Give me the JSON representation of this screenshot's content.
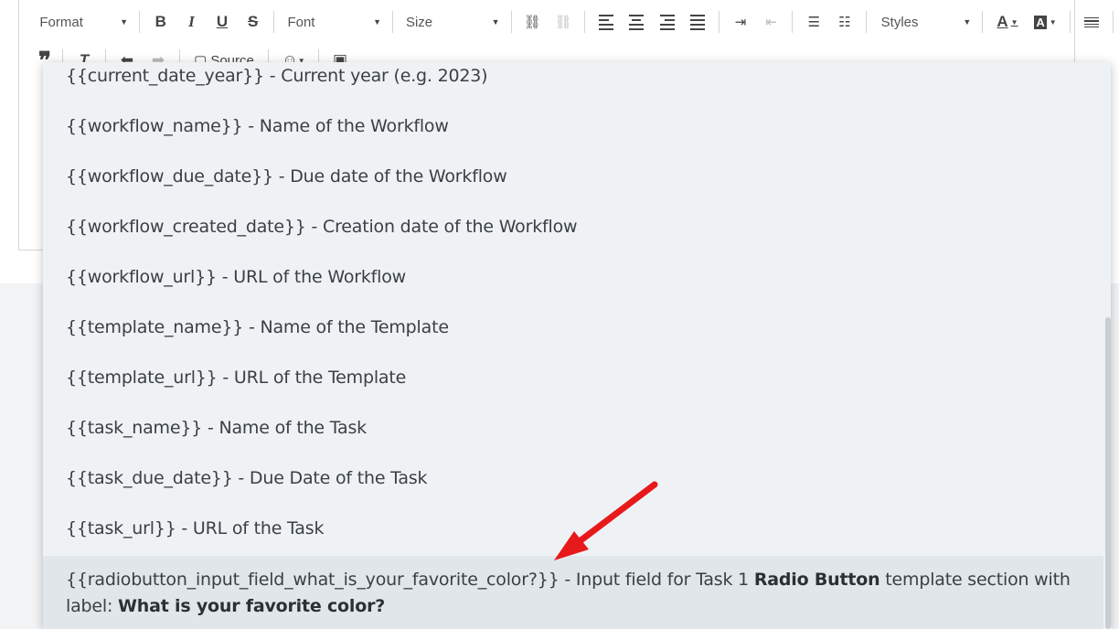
{
  "toolbar": {
    "format_label": "Format",
    "font_label": "Font",
    "size_label": "Size",
    "styles_label": "Styles",
    "source_label": "Source",
    "bold": "B",
    "italic": "I",
    "underline": "U",
    "strike": "S",
    "font_color": "A",
    "bg_color": "A",
    "remove_format": "T"
  },
  "dropdown": {
    "items": [
      {
        "var": "{{current_date_year}}",
        "desc": " - Current year (e.g. 2023)"
      },
      {
        "var": "{{workflow_name}}",
        "desc": " - Name of the Workflow"
      },
      {
        "var": "{{workflow_due_date}}",
        "desc": " - Due date of the Workflow"
      },
      {
        "var": "{{workflow_created_date}}",
        "desc": " - Creation date of the Workflow"
      },
      {
        "var": "{{workflow_url}}",
        "desc": " - URL of the Workflow"
      },
      {
        "var": "{{template_name}}",
        "desc": " - Name of the Template"
      },
      {
        "var": "{{template_url}}",
        "desc": " - URL of the Template"
      },
      {
        "var": "{{task_name}}",
        "desc": " - Name of the Task"
      },
      {
        "var": "{{task_due_date}}",
        "desc": " - Due Date of the Task"
      },
      {
        "var": "{{task_url}}",
        "desc": " - URL of the Task"
      }
    ],
    "selected": {
      "var": "{{radiobutton_input_field_what_is_your_favorite_color?}}",
      "desc_a": " - Input field for Task 1 ",
      "bold_a": "Radio Button",
      "desc_b": " template section with label: ",
      "bold_b": "What is your favorite color?"
    }
  },
  "colors": {
    "annotation_arrow": "#e8191b",
    "dropdown_bg": "#eff2f5",
    "selected_bg": "#e1e6ea"
  }
}
